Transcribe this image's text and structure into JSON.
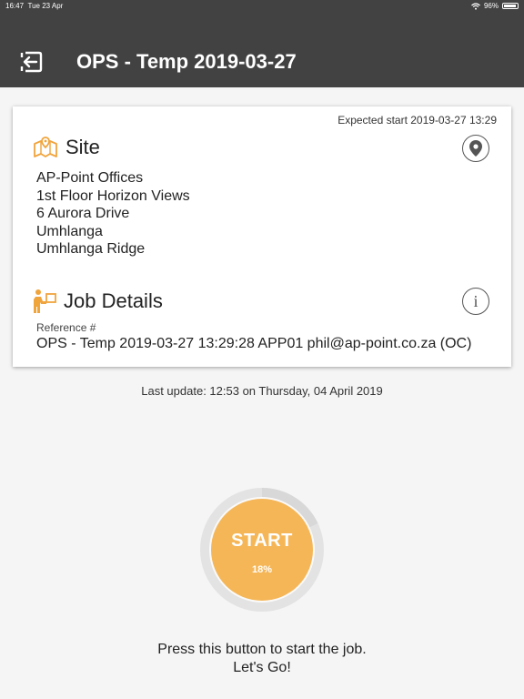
{
  "status_bar": {
    "time": "16:47",
    "date": "Tue 23 Apr",
    "battery": "96%"
  },
  "header": {
    "title": "OPS - Temp 2019-03-27",
    "back_icon": "exit-arrow-icon"
  },
  "card": {
    "expected_start": "Expected start 2019-03-27 13:29",
    "site": {
      "title": "Site",
      "icon": "map-icon",
      "address_lines": [
        "AP-Point Offices",
        "1st Floor Horizon Views",
        "6 Aurora Drive",
        "Umhlanga",
        "Umhlanga Ridge"
      ]
    },
    "job": {
      "title": "Job Details",
      "icon": "worker-icon",
      "reference_label": "Reference #",
      "reference_value": "OPS - Temp 2019-03-27 13:29:28 APP01 phil@ap-point.co.za (OC)"
    }
  },
  "last_update": "Last update: 12:53 on Thursday, 04 April 2019",
  "start": {
    "label": "START",
    "progress_text": "18%",
    "progress": 0.18,
    "color": "#f5b657"
  },
  "hint": {
    "line1": "Press this button to start the job.",
    "line2": "Let's Go!"
  },
  "colors": {
    "appbar": "#424242",
    "accent": "#f0a43c",
    "background": "#f5f5f5"
  }
}
